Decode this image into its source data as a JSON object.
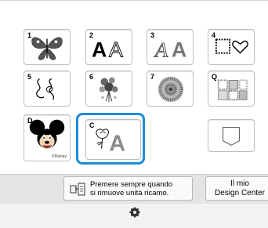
{
  "categories": [
    {
      "number": "1",
      "label": "butterfly-pattern"
    },
    {
      "number": "2",
      "label": "font-AA"
    },
    {
      "number": "3",
      "label": "font-AA-decorative"
    },
    {
      "number": "4",
      "label": "frame-shapes"
    },
    {
      "number": "5",
      "label": "ornamental-swirls"
    },
    {
      "number": "6",
      "label": "floral-bouquet"
    },
    {
      "number": "7",
      "label": "circular-medallion"
    },
    {
      "number": "Q",
      "label": "quilt-patterns"
    },
    {
      "number": "D",
      "label": "disney-designs"
    },
    {
      "number": "C",
      "label": "combined-design"
    },
    {
      "number": "",
      "label": "pocket-storage"
    }
  ],
  "disney_credit": "©Disney",
  "notice": {
    "line1": "Premere sempre quando",
    "line2": "si rimuove unità ricamo."
  },
  "my_design": {
    "line1": "Il mio",
    "line2": "Design Center"
  },
  "colors": {
    "selection_blue": "#1e8cd6"
  }
}
